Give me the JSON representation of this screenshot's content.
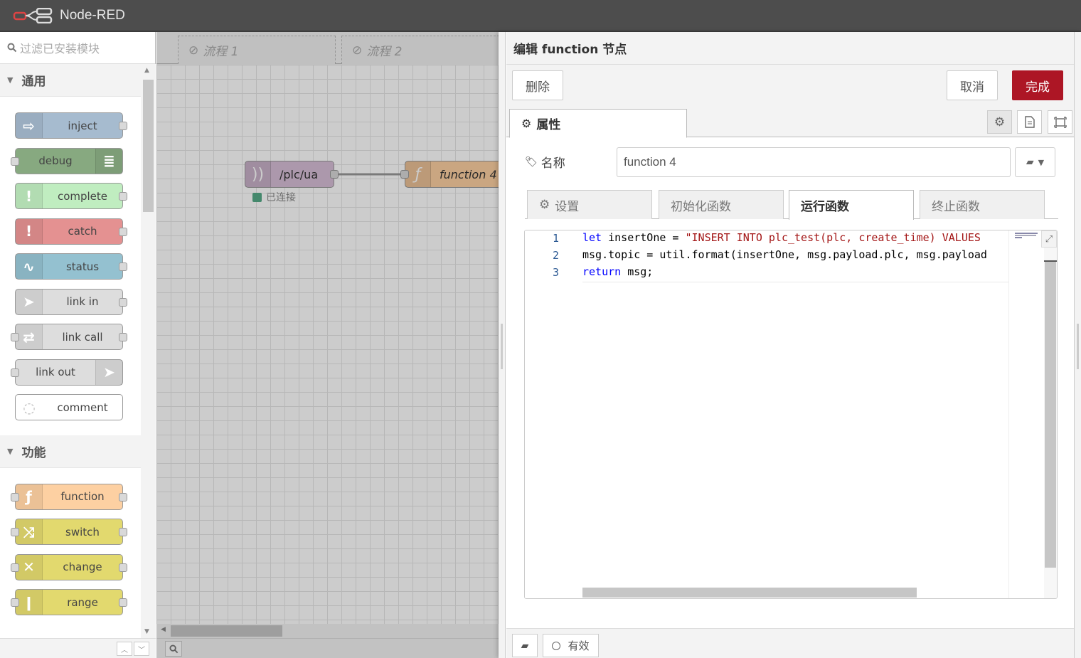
{
  "header": {
    "title": "Node-RED"
  },
  "palette": {
    "search_placeholder": "过滤已安装模块",
    "categories": [
      {
        "name": "通用",
        "nodes": [
          {
            "label": "inject",
            "color": "#a6bbcf",
            "icon": "arrow-in-icon",
            "glyph": "⇨",
            "in": false,
            "out": true
          },
          {
            "label": "debug",
            "color": "#87a980",
            "icon": "list-icon",
            "glyph": "≣",
            "in": true,
            "out": false,
            "icon_right": true
          },
          {
            "label": "complete",
            "color": "#c0edc0",
            "icon": "exclamation-icon",
            "glyph": "!",
            "in": false,
            "out": true
          },
          {
            "label": "catch",
            "color": "#e49191",
            "icon": "exclamation-icon",
            "glyph": "!",
            "in": false,
            "out": true
          },
          {
            "label": "status",
            "color": "#94c1d0",
            "icon": "pulse-icon",
            "glyph": "∿",
            "in": false,
            "out": true
          },
          {
            "label": "link in",
            "color": "#dddddd",
            "icon": "link-in-icon",
            "glyph": "➤",
            "in": false,
            "out": true
          },
          {
            "label": "link call",
            "color": "#dddddd",
            "icon": "link-call-icon",
            "glyph": "⇄",
            "in": true,
            "out": true
          },
          {
            "label": "link out",
            "color": "#dddddd",
            "icon": "link-out-icon",
            "glyph": "➤",
            "in": true,
            "out": false,
            "icon_right": true
          },
          {
            "label": "comment",
            "color": "#ffffff",
            "icon": "comment-icon",
            "glyph": "◌",
            "in": false,
            "out": false
          }
        ]
      },
      {
        "name": "功能",
        "nodes": [
          {
            "label": "function",
            "color": "#fdd0a2",
            "icon": "function-icon",
            "glyph": "ƒ",
            "in": true,
            "out": true
          },
          {
            "label": "switch",
            "color": "#e2d96e",
            "icon": "switch-icon",
            "glyph": "⤨",
            "in": true,
            "out": true
          },
          {
            "label": "change",
            "color": "#e2d96e",
            "icon": "shuffle-icon",
            "glyph": "✕",
            "in": true,
            "out": true
          },
          {
            "label": "range",
            "color": "#e2d96e",
            "icon": "range-icon",
            "glyph": "ǀ",
            "in": true,
            "out": true
          }
        ]
      }
    ]
  },
  "workspace": {
    "tabs": [
      "流程 1",
      "流程 2"
    ],
    "flow_nodes": [
      {
        "label": "/plc/ua",
        "color": "#d8bfd8",
        "icon": "wifi-icon",
        "glyph": "))",
        "status": "已连接"
      },
      {
        "label": "function 4",
        "color": "#fdd0a2",
        "icon": "function-icon",
        "glyph": "ƒ"
      }
    ]
  },
  "tray": {
    "title": "编辑 function 节点",
    "buttons": {
      "delete": "删除",
      "cancel": "取消",
      "done": "完成"
    },
    "properties_tab": "属性",
    "name_label": "名称",
    "name_value": "function 4",
    "sub_tabs": [
      "设置",
      "初始化函数",
      "运行函数",
      "终止函数"
    ],
    "active_sub_tab": 2,
    "code": {
      "line_numbers": [
        "1",
        "2",
        "3"
      ],
      "line1": {
        "kw": "let",
        "text": " insertOne = ",
        "str": "\"INSERT INTO plc_test(plc, create_time) VALUES"
      },
      "line2": {
        "text": "msg.topic = util.format(insertOne, msg.payload.plc, msg.payload"
      },
      "line3": {
        "kw": "return",
        "text": " msg;"
      }
    },
    "footer": {
      "enabled_label": "有效"
    }
  }
}
